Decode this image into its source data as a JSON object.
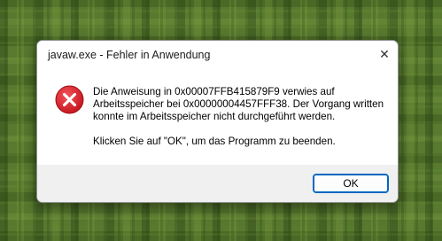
{
  "dialog": {
    "title": "javaw.exe - Fehler in Anwendung",
    "close_symbol": "✕",
    "icon": "error-icon",
    "message_line_1": "Die Anweisung in 0x00007FFB415879F9 verwies auf",
    "message_line_2": "Arbeitsspeicher bei 0x00000004457FFF38. Der Vorgang written",
    "message_line_3": "konnte im Arbeitsspeicher nicht durchgeführt werden.",
    "message_line_4": "Klicken Sie auf \"OK\", um das Programm zu beenden.",
    "ok_label": "OK"
  },
  "colors": {
    "error_red": "#d81e2a",
    "accent": "#0067c0",
    "background": "#587a2f"
  }
}
